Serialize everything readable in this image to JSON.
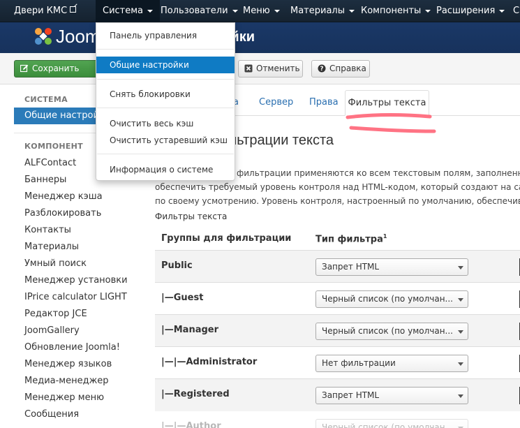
{
  "navbar": {
    "site_name": "Двери КМС",
    "menus": [
      "Система",
      "Пользователи",
      "Меню",
      "Материалы",
      "Компоненты",
      "Расширения",
      "С"
    ]
  },
  "header": {
    "logo_text": "Joomla",
    "title": "ройки"
  },
  "toolbar": {
    "save_label": "Сохранить",
    "cancel_label": "Отменить",
    "help_label": "Справка"
  },
  "dropdown": {
    "items": [
      "Панель управления",
      "Общие настройки",
      "Снять блокировки",
      "Очистить весь кэш",
      "Очистить устаревший кэш",
      "Информация о системе"
    ],
    "active_index": 1
  },
  "sidebar": {
    "system_heading": "СИСТЕМА",
    "active_item": "Общие настройки",
    "component_heading": "КОМПОНЕНТ",
    "items": [
      "ALFContact",
      "Баннеры",
      "Менеджер кэша",
      "Разблокировать",
      "Контакты",
      "Материалы",
      "Умный поиск",
      "Менеджер установки",
      "IPrice calculator LIGHT",
      "Редактор JCE",
      "JoomGallery",
      "Обновление Joomla!",
      "Менеджер языков",
      "Медиа-менеджер",
      "Менеджер меню",
      "Сообщения"
    ]
  },
  "tabs": {
    "items": [
      "а",
      "Сервер",
      "Права"
    ],
    "active": "Фильтры текста"
  },
  "content": {
    "section_title": "фильтрации текста",
    "desc_lines": [
      "фильтрации применяются ко всем текстовым полям, заполненным п",
      "обеспечить требуемый уровень контроля над HTML-кодом, который создают на сайте",
      "по своему усмотрению. Уровень контроля, настроенный по умолчанию, обеспечивает"
    ],
    "filters_label": "Фильтры текста"
  },
  "table": {
    "col_group": "Группы для фильтрации",
    "col_type": "Тип фильтра",
    "col_type_sup": "1",
    "rows": [
      {
        "group": "Public",
        "filter": "Запрет HTML"
      },
      {
        "group": "|—Guest",
        "filter": "Черный список (по умолчан..."
      },
      {
        "group": "|—Manager",
        "filter": "Черный список (по умолчан..."
      },
      {
        "group": "|—|—Administrator",
        "filter": "Нет фильтрации"
      },
      {
        "group": "|—Registered",
        "filter": "Запрет HTML"
      },
      {
        "group": "|—|—Author",
        "filter": "Черный список (по умолчан..."
      }
    ]
  },
  "colors": {
    "navbar": "#1d2e40",
    "header": "#1a3867",
    "save_green": "#46a046",
    "active_blue": "#0f7bc4",
    "annotation_red": "#ff5a6e"
  }
}
